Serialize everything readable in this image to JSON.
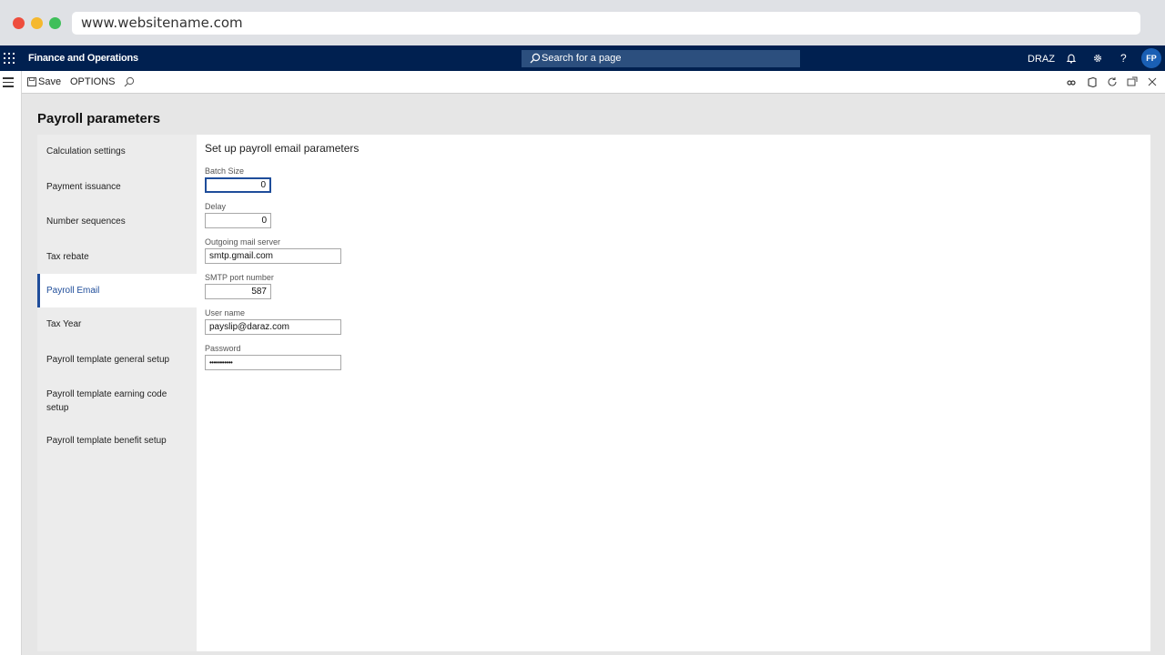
{
  "browser": {
    "url": "www.websitename.com"
  },
  "app": {
    "title": "Finance and Operations",
    "search_placeholder": "Search for a page",
    "company": "DRAZ",
    "avatar_initials": "FP"
  },
  "action_pane": {
    "save_label": "Save",
    "options_label": "OPTIONS"
  },
  "page": {
    "title": "Payroll parameters"
  },
  "tabs": [
    {
      "label": "Calculation settings"
    },
    {
      "label": "Payment issuance"
    },
    {
      "label": "Number sequences"
    },
    {
      "label": "Tax rebate"
    },
    {
      "label": "Payroll Email",
      "selected": true
    },
    {
      "label": "Tax Year"
    },
    {
      "label": "Payroll template general setup"
    },
    {
      "label": "Payroll template earning code setup"
    },
    {
      "label": "Payroll template benefit setup"
    }
  ],
  "email_section": {
    "title": "Set up payroll email parameters",
    "fields": {
      "batch_size": {
        "label": "Batch Size",
        "value": "0"
      },
      "delay": {
        "label": "Delay",
        "value": "0"
      },
      "mail_server": {
        "label": "Outgoing mail server",
        "value": "smtp.gmail.com"
      },
      "smtp_port": {
        "label": "SMTP port number",
        "value": "587"
      },
      "user_name": {
        "label": "User name",
        "value": "payslip@daraz.com"
      },
      "password": {
        "label": "Password",
        "value": "•••••••••••"
      }
    }
  },
  "colors": {
    "nav_bg": "#002050",
    "accent": "#1f4d9a"
  }
}
